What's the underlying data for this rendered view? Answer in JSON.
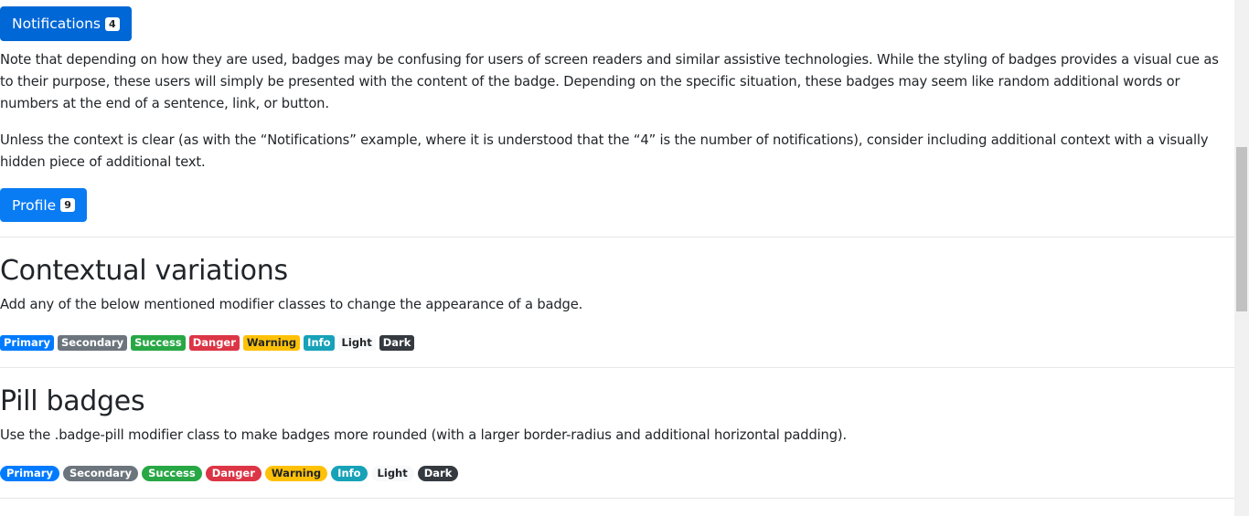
{
  "buttons": {
    "notifications": {
      "label": "Notifications",
      "count": "4"
    },
    "profile": {
      "label": "Profile",
      "count": "9"
    }
  },
  "paragraphs": {
    "accessibility_note": "Note that depending on how they are used, badges may be confusing for users of screen readers and similar assistive technologies. While the styling of badges provides a visual cue as to their purpose, these users will simply be presented with the content of the badge. Depending on the specific situation, these badges may seem like random additional words or numbers at the end of a sentence, link, or button.",
    "context_note": "Unless the context is clear (as with the “Notifications” example, where it is understood that the “4” is the number of notifications), consider including additional context with a visually hidden piece of additional text."
  },
  "contextual": {
    "heading": "Contextual variations",
    "description": "Add any of the below mentioned modifier classes to change the appearance of a badge.",
    "badges": [
      "Primary",
      "Secondary",
      "Success",
      "Danger",
      "Warning",
      "Info",
      "Light",
      "Dark"
    ]
  },
  "pill": {
    "heading": "Pill badges",
    "description": "Use the .badge-pill modifier class to make badges more rounded (with a larger border-radius and additional horizontal padding).",
    "badges": [
      "Primary",
      "Secondary",
      "Success",
      "Danger",
      "Warning",
      "Info",
      "Light",
      "Dark"
    ]
  },
  "colors": {
    "primary": "#007bff",
    "secondary": "#6c757d",
    "success": "#28a745",
    "danger": "#dc3545",
    "warning": "#ffc107",
    "info": "#17a2b8",
    "light": "#f8f9fa",
    "dark": "#343a40"
  }
}
